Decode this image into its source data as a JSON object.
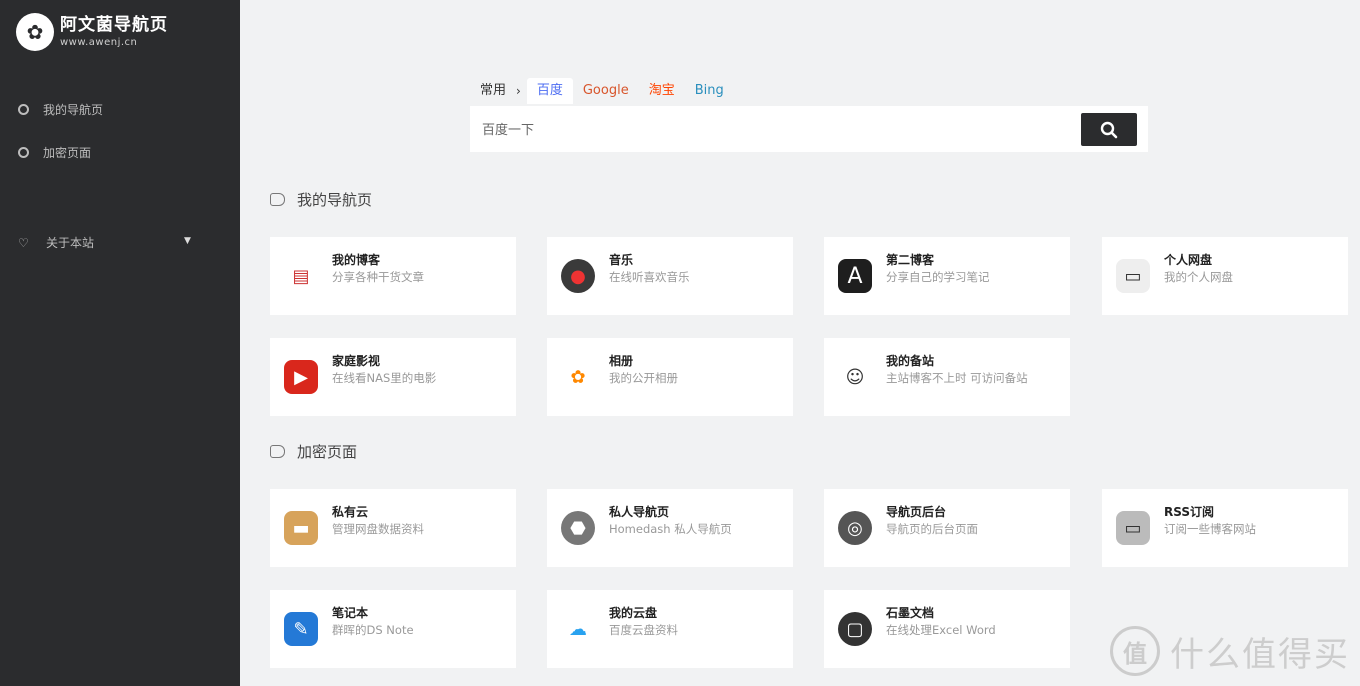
{
  "sidebar": {
    "logo_title": "阿文菌导航页",
    "logo_sub": "www.awenj.cn",
    "items": [
      {
        "label": "我的导航页"
      },
      {
        "label": "加密页面"
      }
    ],
    "about_label": "关于本站"
  },
  "search": {
    "category": "常用",
    "engines": [
      {
        "label": "百度",
        "color": "#4e6ef2"
      },
      {
        "label": "Google",
        "color": "#d8552b"
      },
      {
        "label": "淘宝",
        "color": "#ff4400"
      },
      {
        "label": "Bing",
        "color": "#2a8fbd"
      }
    ],
    "placeholder": "百度一下"
  },
  "sections": [
    {
      "title": "我的导航页",
      "cards": [
        {
          "title": "我的博客",
          "desc": "分享各种干货文章",
          "icon": "blog-icon",
          "bg": "#ffffff",
          "fg": "#c33"
        },
        {
          "title": "音乐",
          "desc": "在线听喜欢音乐",
          "icon": "music-icon",
          "bg": "#3a3a3a",
          "fg": "#e33"
        },
        {
          "title": "第二博客",
          "desc": "分享自己的学习笔记",
          "icon": "letter-a-icon",
          "bg": "#1e1e1e",
          "fg": "#fff"
        },
        {
          "title": "个人网盘",
          "desc": "我的个人网盘",
          "icon": "cloud-drive-icon",
          "bg": "#eeeeee",
          "fg": "#333"
        },
        {
          "title": "家庭影视",
          "desc": "在线看NAS里的电影",
          "icon": "clapper-icon",
          "bg": "#d9271c",
          "fg": "#fff"
        },
        {
          "title": "相册",
          "desc": "我的公开相册",
          "icon": "photos-icon",
          "bg": "#ffffff",
          "fg": "#f80"
        },
        {
          "title": "我的备站",
          "desc": "主站博客不上时 可访问备站",
          "icon": "avatar-icon",
          "bg": "#ffffff",
          "fg": "#333"
        }
      ]
    },
    {
      "title": "加密页面",
      "cards": [
        {
          "title": "私有云",
          "desc": "管理网盘数据资料",
          "icon": "box-icon",
          "bg": "#d7a35b",
          "fg": "#fff"
        },
        {
          "title": "私人导航页",
          "desc": "Homedash 私人导航页",
          "icon": "helmet-icon",
          "bg": "#777777",
          "fg": "#fff"
        },
        {
          "title": "导航页后台",
          "desc": "导航页的后台页面",
          "icon": "dashboard-icon",
          "bg": "#555555",
          "fg": "#fff"
        },
        {
          "title": "RSS订阅",
          "desc": "订阅一些博客网站",
          "icon": "rss-icon",
          "bg": "#bbbbbb",
          "fg": "#333"
        },
        {
          "title": "笔记本",
          "desc": "群晖的DS Note",
          "icon": "notebook-icon",
          "bg": "#2479d6",
          "fg": "#fff"
        },
        {
          "title": "我的云盘",
          "desc": "百度云盘资料",
          "icon": "cloud-icon",
          "bg": "#ffffff",
          "fg": "#28a2f0"
        },
        {
          "title": "石墨文档",
          "desc": "在线处理Excel Word",
          "icon": "shimo-icon",
          "bg": "#333333",
          "fg": "#fff"
        }
      ]
    }
  ],
  "watermark": {
    "mark": "值",
    "text": "什么值得买"
  }
}
